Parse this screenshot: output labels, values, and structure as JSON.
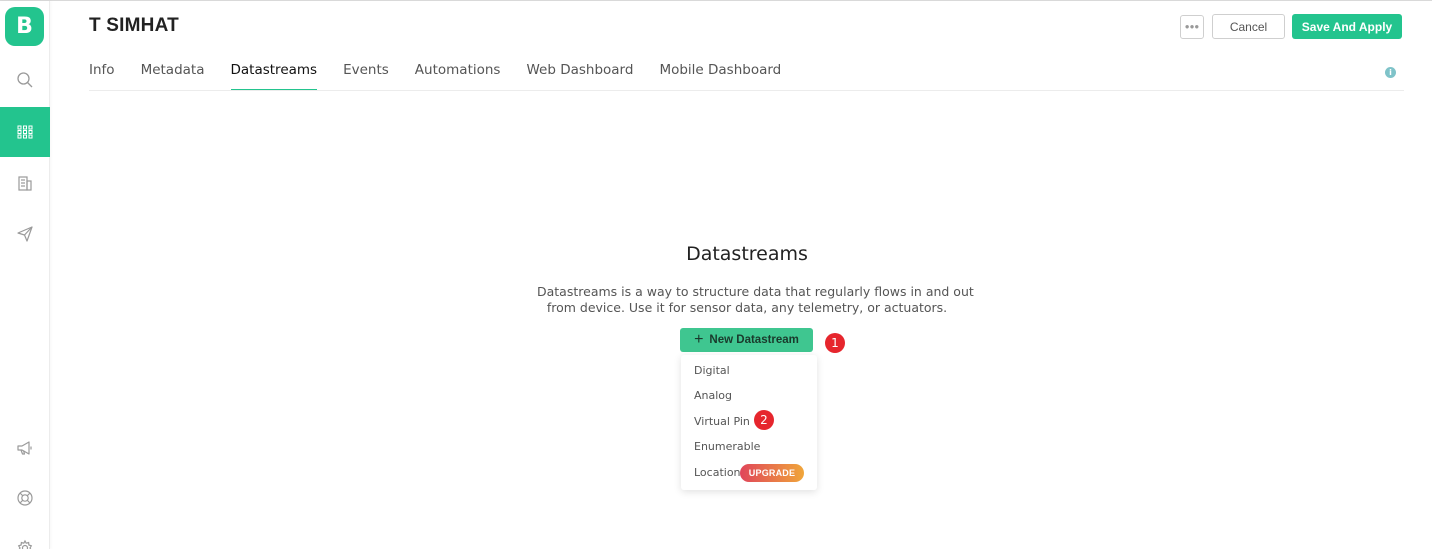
{
  "app": {
    "logo_letter": "B",
    "title": "T SIMHAT"
  },
  "header": {
    "more_icon": "more-dots-icon",
    "cancel_label": "Cancel",
    "save_label": "Save And Apply"
  },
  "tabs": [
    {
      "label": "Info",
      "active": false
    },
    {
      "label": "Metadata",
      "active": false
    },
    {
      "label": "Datastreams",
      "active": true
    },
    {
      "label": "Events",
      "active": false
    },
    {
      "label": "Automations",
      "active": false
    },
    {
      "label": "Web Dashboard",
      "active": false
    },
    {
      "label": "Mobile Dashboard",
      "active": false
    }
  ],
  "info_icon": {
    "glyph": "i"
  },
  "sidebar": {
    "items": [
      {
        "icon": "search-icon"
      },
      {
        "icon": "grid-icon",
        "active": true
      },
      {
        "icon": "building-icon"
      },
      {
        "icon": "send-icon"
      },
      {
        "icon": "megaphone-icon"
      },
      {
        "icon": "lifebuoy-icon"
      },
      {
        "icon": "gear-icon"
      }
    ]
  },
  "empty_state": {
    "title": "Datastreams",
    "desc_line1": "Datastreams is a way to structure data that regularly flows in and out",
    "desc_line2": "from device. Use it for sensor data, any telemetry, or actuators.",
    "new_button": {
      "plus": "+",
      "label": "New Datastream"
    }
  },
  "dropdown": {
    "items": [
      "Digital",
      "Analog",
      "Virtual Pin",
      "Enumerable",
      "Location"
    ],
    "upgrade_label": "UPGRADE"
  },
  "badges": {
    "first": "1",
    "second": "2"
  },
  "colors": {
    "accent": "#23c48e",
    "badge": "#e6262d"
  }
}
